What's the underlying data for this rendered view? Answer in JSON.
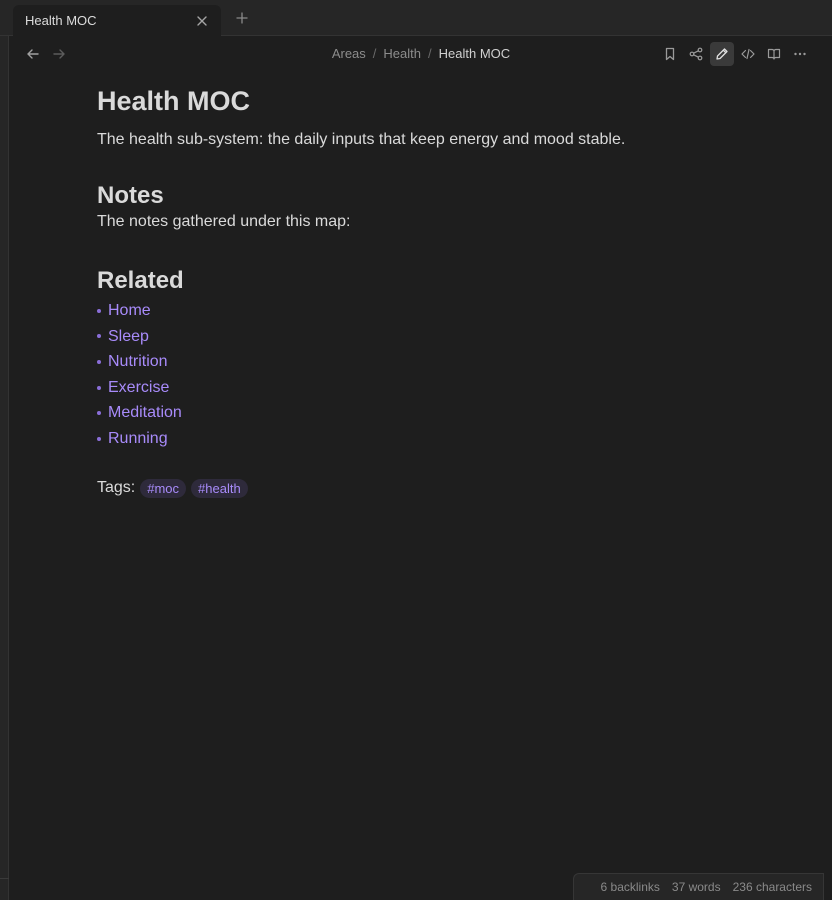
{
  "tab": {
    "title": "Health MOC"
  },
  "breadcrumb": {
    "items": [
      "Areas",
      "Health"
    ],
    "current": "Health MOC",
    "separator": "/"
  },
  "icons": {
    "back": "arrow-left-icon",
    "forward": "arrow-right-icon",
    "bookmark": "bookmark-icon",
    "share": "share-icon",
    "edit": "pencil-icon",
    "source": "code-icon",
    "reading": "book-open-icon",
    "more": "more-horizontal-icon",
    "close": "close-icon",
    "new_tab": "plus-icon"
  },
  "note": {
    "title": "Health MOC",
    "intro": "The health sub-system: the daily inputs that keep energy and mood stable.",
    "notes_heading": "Notes",
    "notes_text": "The notes gathered under this map:",
    "related_heading": "Related",
    "related_links": [
      "Home",
      "Sleep",
      "Nutrition",
      "Exercise",
      "Meditation",
      "Running"
    ],
    "tags_label": "Tags:",
    "tags": [
      "#moc",
      "#health"
    ]
  },
  "status": {
    "backlinks": "6 backlinks",
    "words": "37 words",
    "characters": "236 characters"
  },
  "colors": {
    "background": "#1e1e1e",
    "accent": "#a88bfa",
    "tag_background": "#2e2a3b"
  }
}
